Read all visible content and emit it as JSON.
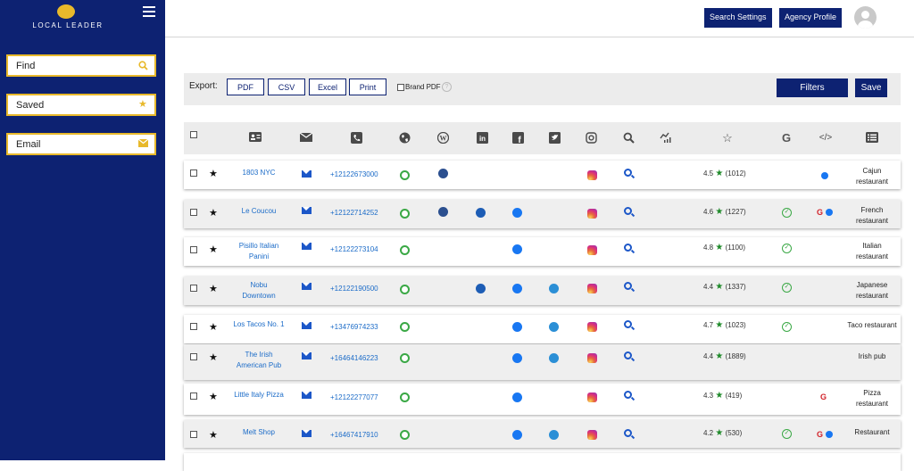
{
  "sidebar": {
    "logo_text": "LOCAL LEADER",
    "find_label": "Find",
    "saved_label": "Saved",
    "email_label": "Email"
  },
  "topbar": {
    "search_settings": "Search Settings",
    "agency_profile": "Agency Profile"
  },
  "export": {
    "label": "Export:",
    "pdf": "PDF",
    "csv": "CSV",
    "excel": "Excel",
    "print": "Print",
    "brand_pdf": "Brand PDF",
    "filters": "Filters",
    "save": "Save"
  },
  "colors": {
    "navy": "#0d2272",
    "gold": "#e8b92b",
    "link_blue": "#1c6cc8",
    "green": "#3aa845"
  },
  "rows": [
    {
      "name_l1": "1803 NYC",
      "name_l2": "",
      "phone": "+12122673000",
      "web": true,
      "wp": true,
      "li": false,
      "fb": false,
      "tw": false,
      "ig": true,
      "rating": "4.5",
      "reviews": "(1012)",
      "google": false,
      "code_g": false,
      "code_fb": true,
      "cat_l1": "Cajun",
      "cat_l2": "restaurant"
    },
    {
      "name_l1": "Le Coucou",
      "name_l2": "",
      "phone": "+12122714252",
      "web": true,
      "wp": true,
      "li": true,
      "fb": true,
      "tw": false,
      "ig": true,
      "rating": "4.6",
      "reviews": "(1227)",
      "google": true,
      "code_g": true,
      "code_fb": true,
      "cat_l1": "French",
      "cat_l2": "restaurant"
    },
    {
      "name_l1": "Pisillo Italian",
      "name_l2": "Panini",
      "phone": "+12122273104",
      "web": true,
      "wp": false,
      "li": false,
      "fb": true,
      "tw": false,
      "ig": true,
      "rating": "4.8",
      "reviews": "(1100)",
      "google": true,
      "code_g": false,
      "code_fb": false,
      "cat_l1": "Italian",
      "cat_l2": "restaurant"
    },
    {
      "name_l1": "Nobu",
      "name_l2": "Downtown",
      "phone": "+12122190500",
      "web": true,
      "wp": false,
      "li": true,
      "fb": true,
      "tw": true,
      "ig": true,
      "rating": "4.4",
      "reviews": "(1337)",
      "google": true,
      "code_g": false,
      "code_fb": false,
      "cat_l1": "Japanese",
      "cat_l2": "restaurant"
    },
    {
      "name_l1": "Los Tacos No. 1",
      "name_l2": "",
      "phone": "+13476974233",
      "web": true,
      "wp": false,
      "li": false,
      "fb": true,
      "tw": true,
      "ig": true,
      "rating": "4.7",
      "reviews": "(1023)",
      "google": true,
      "code_g": false,
      "code_fb": false,
      "cat_l1": "Taco restaurant",
      "cat_l2": ""
    },
    {
      "name_l1": "The Irish",
      "name_l2": "American Pub",
      "phone": "+16464146223",
      "web": true,
      "wp": false,
      "li": false,
      "fb": true,
      "tw": true,
      "ig": true,
      "rating": "4.4",
      "reviews": "(1889)",
      "google": false,
      "code_g": false,
      "code_fb": false,
      "cat_l1": "Irish pub",
      "cat_l2": ""
    },
    {
      "name_l1": "Little Italy Pizza",
      "name_l2": "",
      "phone": "+12122277077",
      "web": true,
      "wp": false,
      "li": false,
      "fb": true,
      "tw": false,
      "ig": true,
      "rating": "4.3",
      "reviews": "(419)",
      "google": false,
      "code_g": true,
      "code_fb": false,
      "cat_l1": "Pizza",
      "cat_l2": "restaurant"
    },
    {
      "name_l1": "Melt Shop",
      "name_l2": "",
      "phone": "+16467417910",
      "web": true,
      "wp": false,
      "li": false,
      "fb": true,
      "tw": true,
      "ig": true,
      "rating": "4.2",
      "reviews": "(530)",
      "google": true,
      "code_g": true,
      "code_fb": true,
      "cat_l1": "Restaurant",
      "cat_l2": ""
    }
  ]
}
